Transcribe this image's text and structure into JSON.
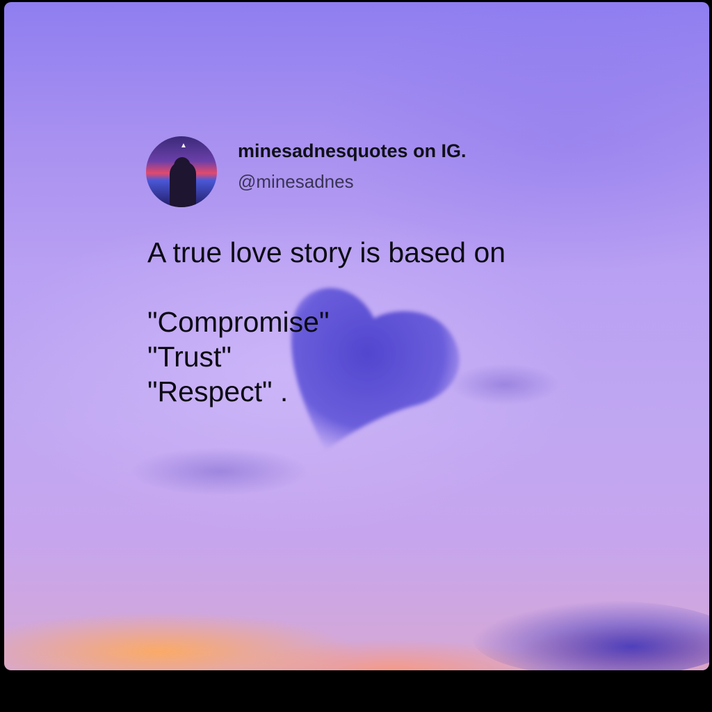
{
  "profile": {
    "name": "minesadnesquotes on IG.",
    "handle": "@minesadnes"
  },
  "quote": {
    "lines": [
      "A true love story is based on",
      "\"Compromise\"",
      "\"Trust\"",
      "\"Respect\" ."
    ]
  },
  "colors": {
    "sky_top": "#8f7ef0",
    "sky_mid": "#c0a7f2",
    "heart_cloud": "#5a4fd6",
    "sunset": "#ffaa5a",
    "text": "#0c0a14"
  }
}
